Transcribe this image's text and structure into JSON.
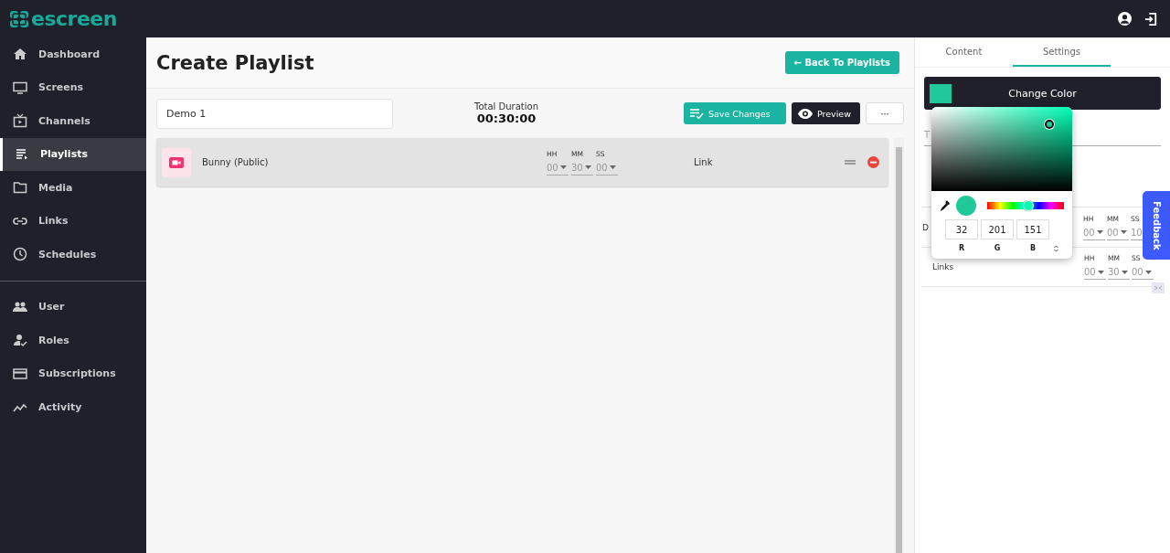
{
  "topbar": {
    "logo": "escreen"
  },
  "sidebar": {
    "items": [
      {
        "label": "Dashboard",
        "selected": false
      },
      {
        "label": "Screens",
        "selected": false
      },
      {
        "label": "Channels",
        "selected": false
      },
      {
        "label": "Playlists",
        "selected": true
      },
      {
        "label": "Media",
        "selected": false
      },
      {
        "label": "Links",
        "selected": false
      },
      {
        "label": "Schedules",
        "selected": false
      }
    ],
    "admin_items": [
      {
        "label": "User",
        "selected": false
      },
      {
        "label": "Roles",
        "selected": false
      },
      {
        "label": "Subscriptions",
        "selected": false
      },
      {
        "label": "Activity",
        "selected": false
      }
    ]
  },
  "page": {
    "title": "Create Playlist",
    "back_button": "← Back To Playlists"
  },
  "toolbar": {
    "name": "Demo 1",
    "total_duration_label": "Total Duration",
    "total_duration": "00:30:00",
    "save_button": "Save Changes",
    "preview_button": "Preview",
    "more_button": "···"
  },
  "playlist_items": [
    {
      "name": "Bunny (Public)",
      "hh_label": "HH",
      "mm_label": "MM",
      "ss_label": "SS",
      "hh": "00",
      "mm": "30",
      "ss": "00",
      "type": "Link"
    }
  ],
  "right_panel": {
    "tabs": [
      {
        "label": "Content",
        "selected": false
      },
      {
        "label": "Settings",
        "selected": true
      }
    ],
    "change_color_button": "Change Color",
    "field_label": "T",
    "rows": [
      {
        "label": "D",
        "hh_label": "HH",
        "mm_label": "MM",
        "ss_label": "SS",
        "hh": "00",
        "mm": "00",
        "ss": "10"
      },
      {
        "label": "Links",
        "hh_label": "HH",
        "mm_label": "MM",
        "ss_label": "SS",
        "hh": "00",
        "mm": "30",
        "ss": "00"
      }
    ]
  },
  "color_picker": {
    "r": "32",
    "g": "201",
    "b": "151",
    "r_label": "R",
    "g_label": "G",
    "b_label": "B",
    "hue_slider": {
      "level": 0.54
    }
  },
  "feedback_tab": "Feedback"
}
